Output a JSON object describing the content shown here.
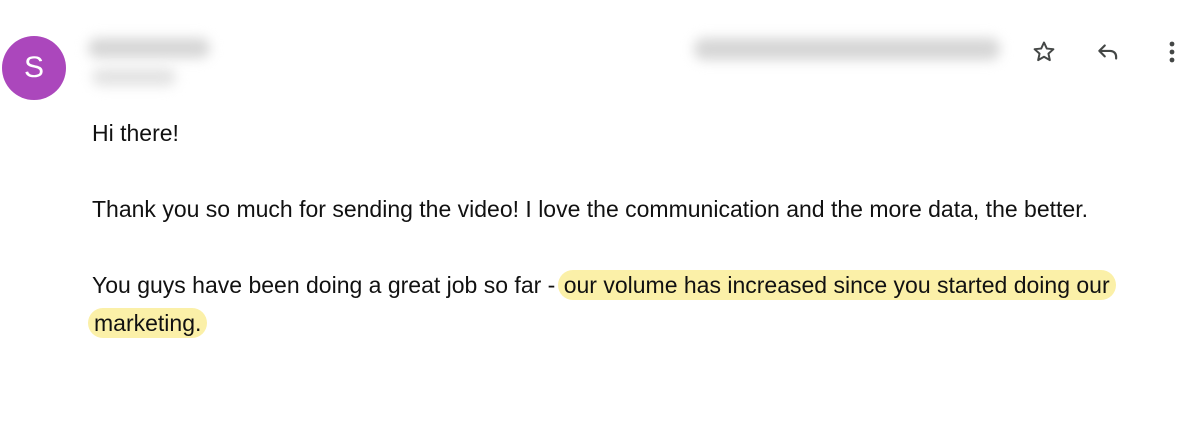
{
  "sender": {
    "avatar_letter": "S",
    "avatar_color": "#ab47bc"
  },
  "toolbar": {
    "star_icon": "star-outline-icon",
    "reply_icon": "reply-icon",
    "more_icon": "more-vertical-icon"
  },
  "message": {
    "greeting": "Hi there!",
    "paragraph1": "Thank you so much for sending the video! I love the communication and the more data, the better.",
    "paragraph2_lead": "You guys have been doing a great job so far - ",
    "paragraph2_highlight": "our volume has increased since you started doing our marketing."
  },
  "colors": {
    "highlight": "#fbf0a8",
    "text": "#111111",
    "icon": "#444746"
  }
}
